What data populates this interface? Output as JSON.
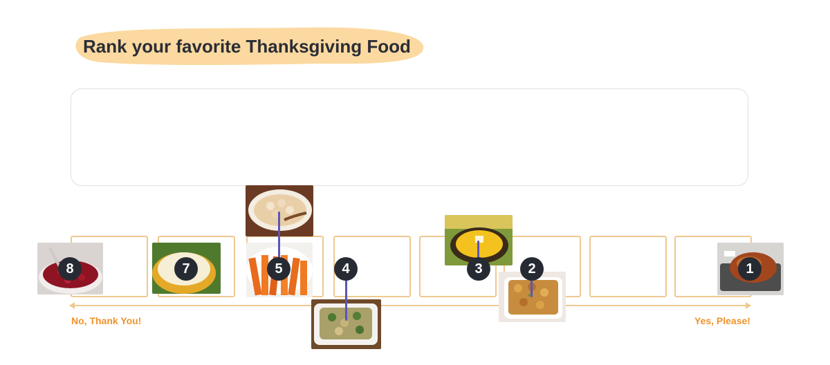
{
  "header": {
    "title": "Rank your favorite Thanksgiving Food"
  },
  "scale": {
    "left_label": "No, Thank You!",
    "right_label": "Yes, Please!"
  },
  "foods": [
    {
      "rank": "1",
      "name": "roast-turkey"
    },
    {
      "rank": "2",
      "name": "stuffing"
    },
    {
      "rank": "3",
      "name": "corn"
    },
    {
      "rank": "4",
      "name": "green-bean-casserole"
    },
    {
      "rank": "5",
      "name": "candied-yams"
    },
    {
      "rank": "7",
      "name": "mashed-potatoes"
    },
    {
      "rank": "8",
      "name": "cranberry-sauce"
    },
    {
      "rank": "",
      "name": "sweet-potato-casserole"
    }
  ],
  "colors": {
    "accent": "#f0932b",
    "slot_border": "#efc890",
    "highlight": "#fbd9a0",
    "badge": "#262b33",
    "stem": "#5a55b8"
  }
}
